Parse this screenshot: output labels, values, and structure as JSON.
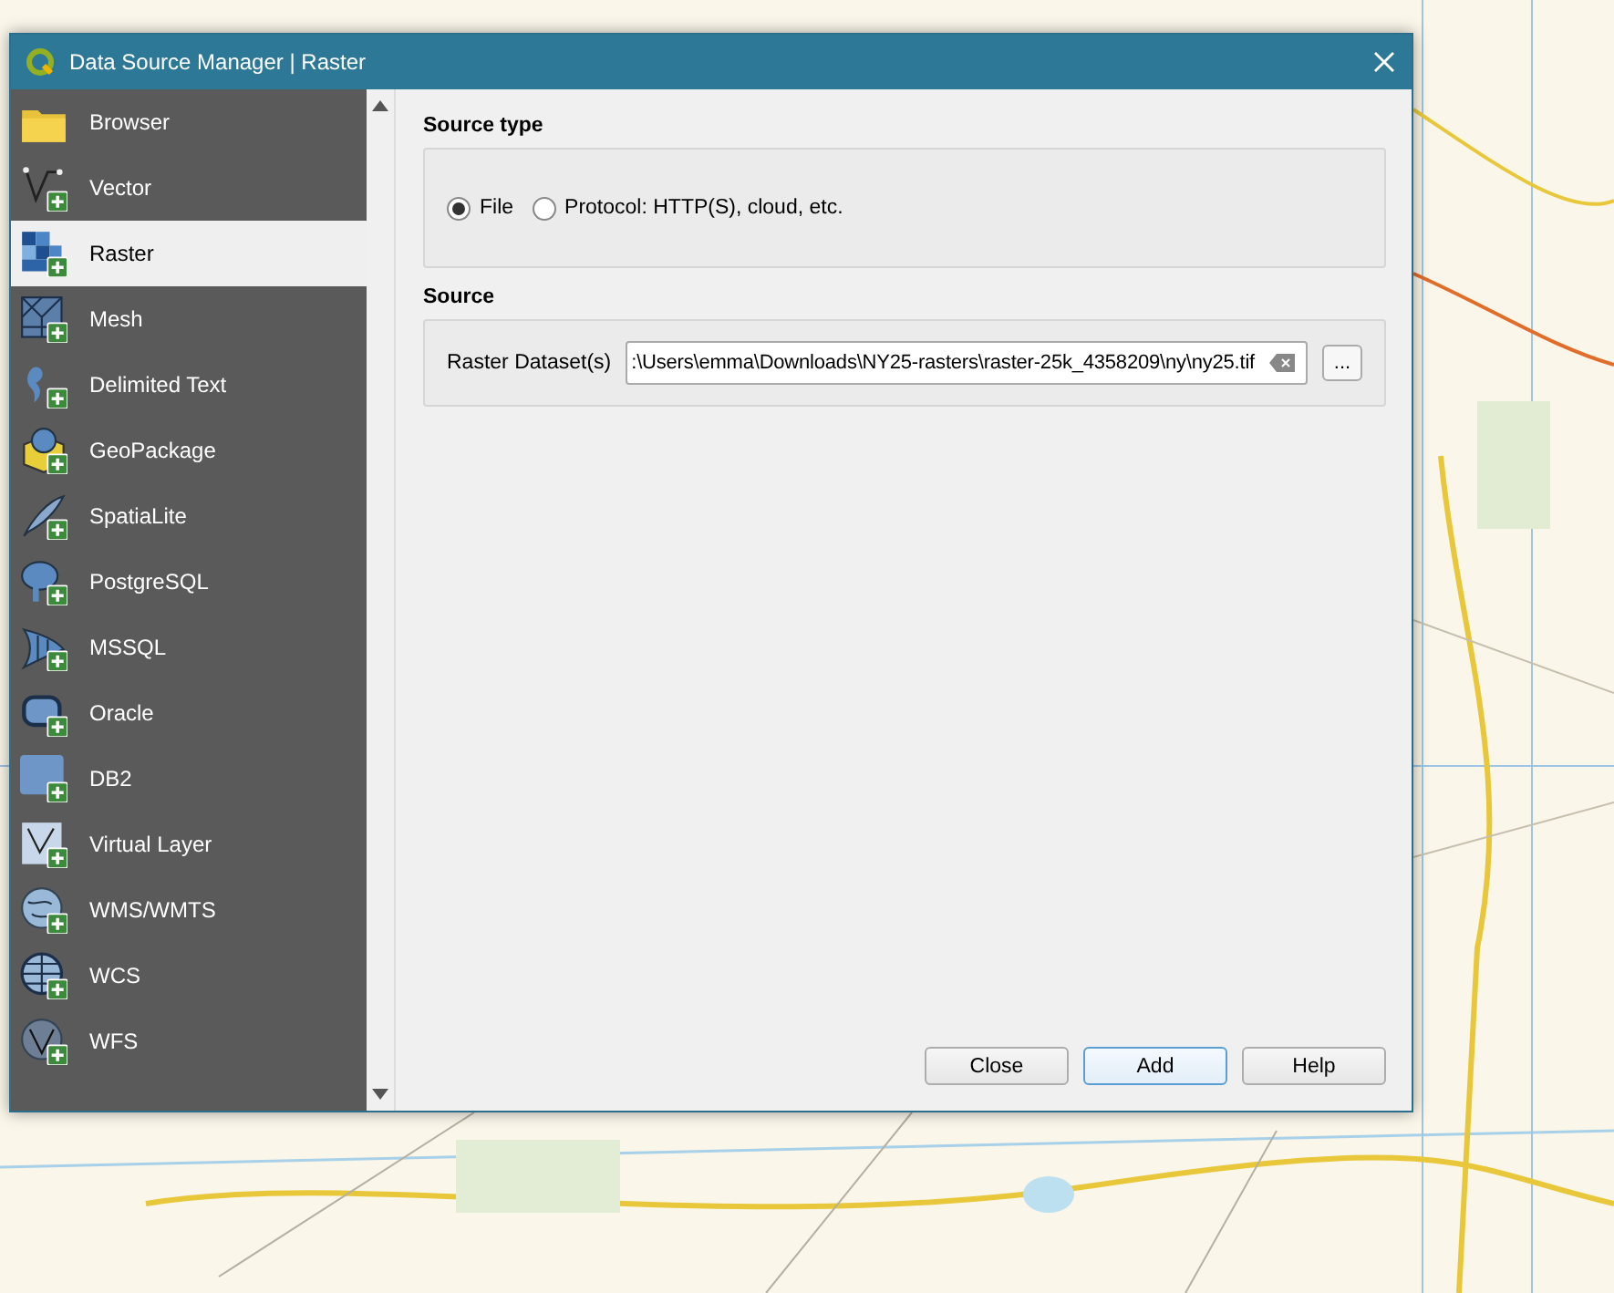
{
  "window": {
    "title": "Data Source Manager | Raster"
  },
  "sidebar": {
    "items": [
      {
        "label": "Browser",
        "selected": false
      },
      {
        "label": "Vector",
        "selected": false
      },
      {
        "label": "Raster",
        "selected": true
      },
      {
        "label": "Mesh",
        "selected": false
      },
      {
        "label": "Delimited Text",
        "selected": false
      },
      {
        "label": "GeoPackage",
        "selected": false
      },
      {
        "label": "SpatiaLite",
        "selected": false
      },
      {
        "label": "PostgreSQL",
        "selected": false
      },
      {
        "label": "MSSQL",
        "selected": false
      },
      {
        "label": "Oracle",
        "selected": false
      },
      {
        "label": "DB2",
        "selected": false
      },
      {
        "label": "Virtual Layer",
        "selected": false
      },
      {
        "label": "WMS/WMTS",
        "selected": false
      },
      {
        "label": "WCS",
        "selected": false
      },
      {
        "label": "WFS",
        "selected": false
      }
    ]
  },
  "source_type": {
    "title": "Source type",
    "options": [
      {
        "label": "File",
        "selected": true
      },
      {
        "label": "Protocol: HTTP(S), cloud, etc.",
        "selected": false
      }
    ]
  },
  "source": {
    "title": "Source",
    "label": "Raster Dataset(s)",
    "value": ":\\Users\\emma\\Downloads\\NY25-rasters\\raster-25k_4358209\\ny\\ny25.tif",
    "browse": "..."
  },
  "buttons": [
    {
      "label": "Close",
      "default": false
    },
    {
      "label": "Add",
      "default": true
    },
    {
      "label": "Help",
      "default": false
    }
  ]
}
